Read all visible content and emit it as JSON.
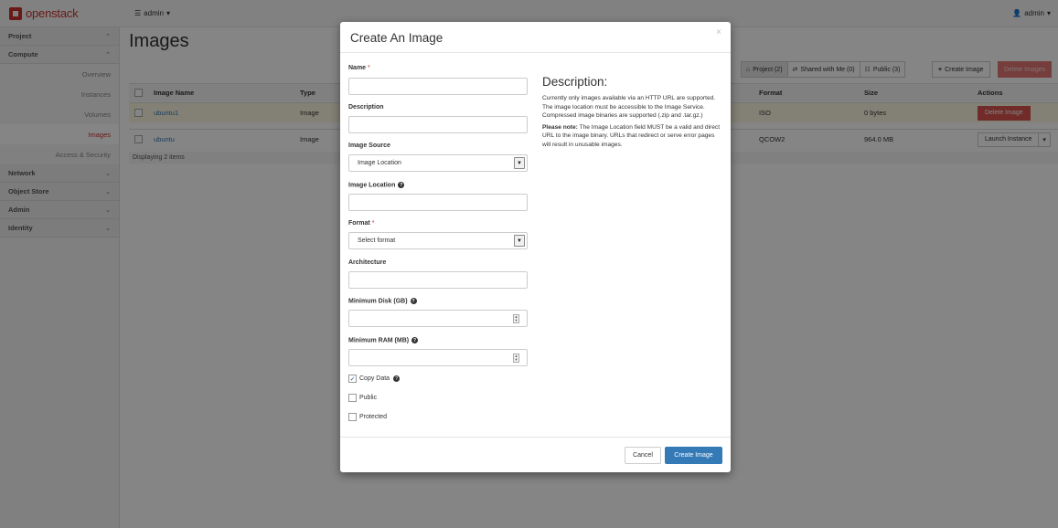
{
  "navbar": {
    "logo_text": "openstack",
    "project_menu": "admin",
    "user_menu": "admin"
  },
  "sidebar": {
    "sections": [
      {
        "label": "Project"
      },
      {
        "label": "Compute"
      }
    ],
    "compute_items": [
      "Overview",
      "Instances",
      "Volumes",
      "Images",
      "Access & Security"
    ],
    "active_item": "Images",
    "collapsed_sections": [
      "Network",
      "Object Store",
      "Admin",
      "Identity"
    ]
  },
  "page": {
    "title": "Images"
  },
  "filters": [
    {
      "icon": "home-icon",
      "label": "Project (2)"
    },
    {
      "icon": "shared-icon",
      "label": "Shared with Me (0)"
    },
    {
      "icon": "public-icon",
      "label": "Public (3)"
    }
  ],
  "actions": {
    "create_image": "Create Image",
    "delete_images": "Delete Images"
  },
  "table": {
    "columns": [
      "Image Name",
      "Type",
      "Format",
      "Size",
      "Actions"
    ],
    "rows": [
      {
        "name": "ubuntu1",
        "type": "Image",
        "format": "ISO",
        "size": "0 bytes",
        "action": "Delete Image"
      },
      {
        "name": "ubuntu",
        "type": "Image",
        "format": "QCOW2",
        "size": "964.0 MB",
        "action": "Launch Instance"
      }
    ],
    "footer": "Displaying 2 items"
  },
  "modal": {
    "title": "Create An Image",
    "close": "×",
    "fields": {
      "name_label": "Name",
      "description_label": "Description",
      "image_source_label": "Image Source",
      "image_source_value": "Image Location",
      "image_location_label": "Image Location",
      "format_label": "Format",
      "format_value": "Select format",
      "architecture_label": "Architecture",
      "min_disk_label": "Minimum Disk (GB)",
      "min_ram_label": "Minimum RAM (MB)",
      "copy_data_label": "Copy Data",
      "public_label": "Public",
      "protected_label": "Protected",
      "required_mark": "*"
    },
    "checkboxes": {
      "copy_data": true,
      "public": false,
      "protected": false
    },
    "description": {
      "title": "Description:",
      "p1": "Currently only images available via an HTTP URL are supported. The image location must be accessible to the Image Service. Compressed image binaries are supported (.zip and .tar.gz.)",
      "note_label": "Please note:",
      "p2": "The Image Location field MUST be a valid and direct URL to the image binary. URLs that redirect or serve error pages will result in unusable images."
    },
    "buttons": {
      "cancel": "Cancel",
      "create": "Create Image"
    }
  },
  "colors": {
    "brand": "#c9302c",
    "primary": "#337ab7",
    "danger": "#d9534f",
    "highlight_row": "#fcf8e3"
  }
}
